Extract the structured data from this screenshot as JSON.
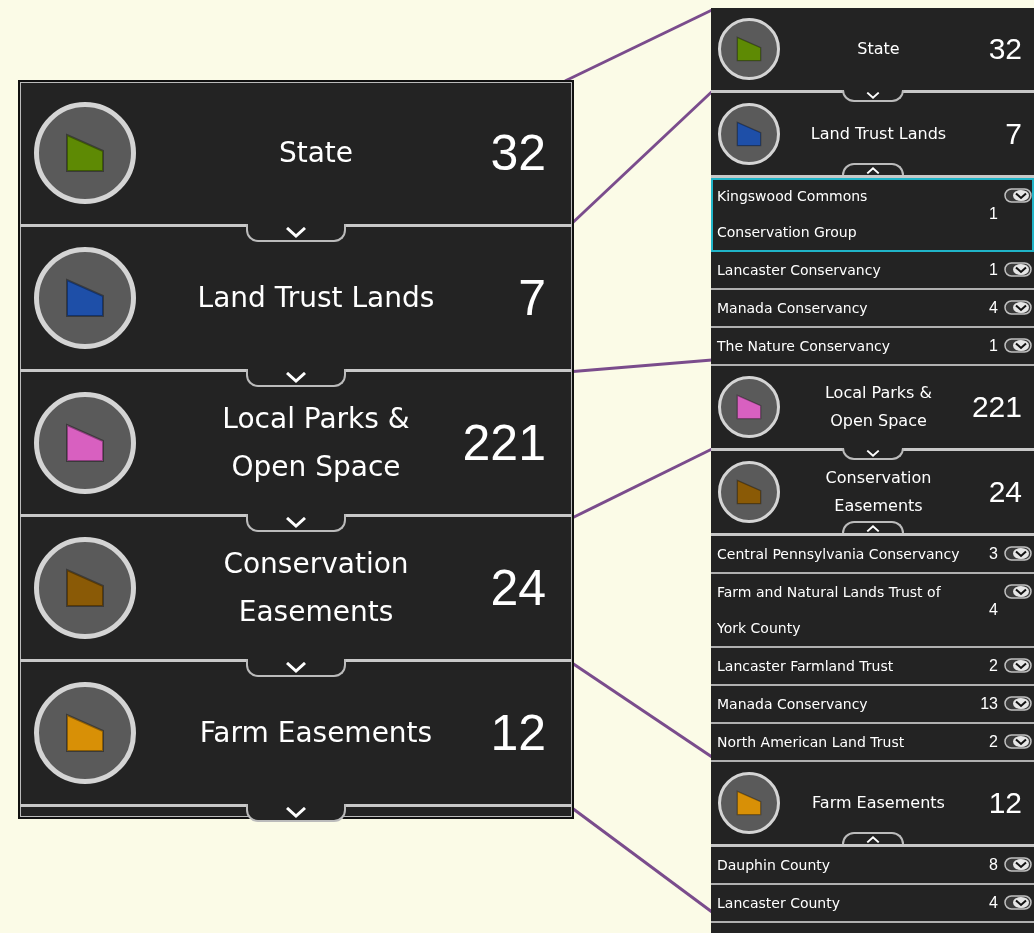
{
  "panels": [
    {
      "kind": "large",
      "categories": [
        {
          "label": "State",
          "count": "32",
          "color": "#5e8a04",
          "expanded": false
        },
        {
          "label": "Land Trust Lands",
          "count": "7",
          "color": "#1e4fa8",
          "expanded": false
        },
        {
          "label": "Local Parks &\nOpen Space",
          "count": "221",
          "color": "#d860c0",
          "expanded": false
        },
        {
          "label": "Conservation\nEasements",
          "count": "24",
          "color": "#8a5a06",
          "expanded": false
        },
        {
          "label": "Farm Easements",
          "count": "12",
          "color": "#d89006",
          "expanded": false
        }
      ]
    },
    {
      "kind": "compact",
      "categories": [
        {
          "label": "State",
          "count": "32",
          "color": "#5e8a04",
          "expanded": false
        },
        {
          "label": "Land Trust Lands",
          "count": "7",
          "color": "#1e4fa8",
          "expanded": true,
          "items": [
            {
              "name": "Kingswood Commons\nConservation Group",
              "count": "1",
              "selected": true
            },
            {
              "name": "Lancaster Conservancy",
              "count": "1",
              "selected": false
            },
            {
              "name": "Manada Conservancy",
              "count": "4",
              "selected": false
            },
            {
              "name": "The Nature Conservancy",
              "count": "1",
              "selected": false
            }
          ]
        },
        {
          "label": "Local Parks &\nOpen Space",
          "count": "221",
          "color": "#d860c0",
          "expanded": false
        },
        {
          "label": "Conservation\nEasements",
          "count": "24",
          "color": "#8a5a06",
          "expanded": true,
          "items": [
            {
              "name": "Central Pennsylvania Conservancy",
              "count": "3",
              "selected": false
            },
            {
              "name": "Farm and Natural Lands Trust of\nYork County",
              "count": "4",
              "selected": false
            },
            {
              "name": "Lancaster Farmland Trust",
              "count": "2",
              "selected": false
            },
            {
              "name": "Manada Conservancy",
              "count": "13",
              "selected": false
            },
            {
              "name": "North American Land Trust",
              "count": "2",
              "selected": false
            }
          ]
        },
        {
          "label": "Farm Easements",
          "count": "12",
          "color": "#d89006",
          "expanded": true,
          "items": [
            {
              "name": "Dauphin County",
              "count": "8",
              "selected": false
            },
            {
              "name": "Lancaster County",
              "count": "4",
              "selected": false
            }
          ]
        }
      ]
    }
  ]
}
